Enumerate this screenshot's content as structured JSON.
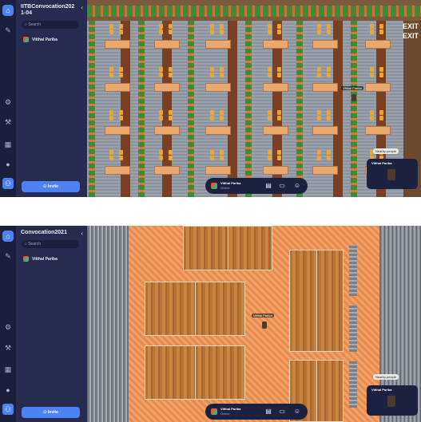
{
  "screens": [
    {
      "space_title": "IITBConvocation2021-04",
      "collapse_icon": "chevron-left-icon",
      "search_placeholder": "Search",
      "member_name": "Vitthal Pariba",
      "invite_label": "Invite",
      "map_labels": {
        "exit_1": "EXIT",
        "exit_2": "EXIT"
      },
      "player_tag": "Vitthal Pariba",
      "bubble_text": "Nearby people",
      "video_name": "Vitthal Pariba",
      "dock": {
        "name": "Vitthal Pariba",
        "status": "Online"
      }
    },
    {
      "space_title": "Convocation2021",
      "collapse_icon": "chevron-left-icon",
      "search_placeholder": "Search",
      "member_name": "Vitthal Pariba",
      "invite_label": "Invite",
      "player_tag": "Vitthal Pariba",
      "bubble_text": "Nearby people",
      "video_name": "Vitthal Pariba",
      "dock": {
        "name": "Vitthal Pariba",
        "status": "Online"
      }
    }
  ],
  "rail_icons": [
    "home-icon",
    "pin-icon",
    "settings-icon",
    "tools-icon",
    "calendar-icon",
    "chat-icon",
    "users-icon"
  ],
  "dock_icons": [
    "map-icon",
    "screen-share-icon",
    "emoji-icon"
  ],
  "colors": {
    "accent": "#4b83f4",
    "sidebar": "#262b4f",
    "rail": "#1b1f3b"
  }
}
